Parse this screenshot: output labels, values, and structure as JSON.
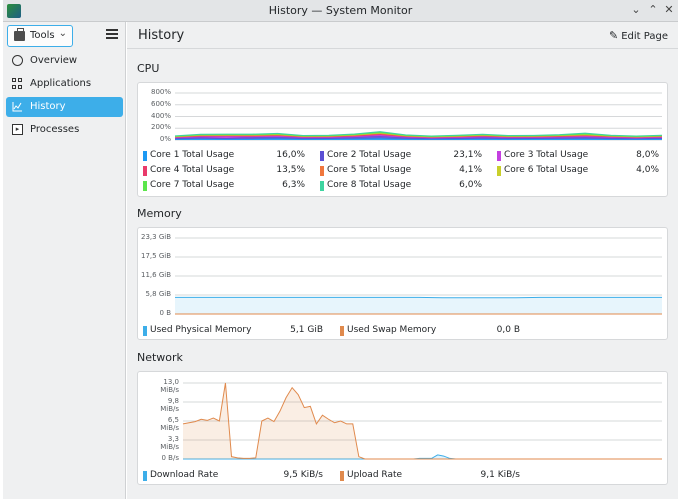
{
  "window": {
    "title": "History — System Monitor"
  },
  "toolbar": {
    "tools_label": "Tools"
  },
  "sidebar": {
    "items": [
      {
        "label": "Overview",
        "icon": "gauge-icon"
      },
      {
        "label": "Applications",
        "icon": "applications-grid-icon"
      },
      {
        "label": "History",
        "icon": "history-chart-icon",
        "active": true
      },
      {
        "label": "Processes",
        "icon": "terminal-icon"
      }
    ]
  },
  "header": {
    "title": "History",
    "edit_label": "Edit Page"
  },
  "cpu": {
    "title": "CPU",
    "legend": [
      {
        "name": "Core 1 Total Usage",
        "value": "16,0%",
        "color": "#1d99f3"
      },
      {
        "name": "Core 2 Total Usage",
        "value": "23,1%",
        "color": "#5a4fd4"
      },
      {
        "name": "Core 3 Total Usage",
        "value": "8,0%",
        "color": "#c43fe0"
      },
      {
        "name": "Core 4 Total Usage",
        "value": "13,5%",
        "color": "#e93a6b"
      },
      {
        "name": "Core 5 Total Usage",
        "value": "4,1%",
        "color": "#f0773d"
      },
      {
        "name": "Core 6 Total Usage",
        "value": "4,0%",
        "color": "#c9cf2b"
      },
      {
        "name": "Core 7 Total Usage",
        "value": "6,3%",
        "color": "#5ce64c"
      },
      {
        "name": "Core 8 Total Usage",
        "value": "6,0%",
        "color": "#3ed4a0"
      }
    ]
  },
  "memory": {
    "title": "Memory",
    "legend": [
      {
        "name": "Used Physical Memory",
        "value": "5,1 GiB",
        "color": "#3daee9"
      },
      {
        "name": "Used Swap Memory",
        "value": "0,0 B",
        "color": "#e08a4d"
      }
    ]
  },
  "network": {
    "title": "Network",
    "legend": [
      {
        "name": "Download Rate",
        "value": "9,5 KiB/s",
        "color": "#3daee9"
      },
      {
        "name": "Upload Rate",
        "value": "9,1 KiB/s",
        "color": "#e08a4d"
      }
    ]
  },
  "chart_data": [
    {
      "type": "area",
      "title": "CPU",
      "y_ticks": [
        "800%",
        "600%",
        "400%",
        "200%",
        "0%"
      ],
      "ylim": [
        0,
        800
      ],
      "grid": true,
      "legend_placement": "bottom",
      "series": [
        {
          "name": "Core 1 Total Usage",
          "color": "#1d99f3",
          "values": [
            12,
            20,
            15,
            18,
            25,
            14,
            16,
            22,
            30,
            18,
            12,
            15,
            20,
            14,
            16,
            18,
            22,
            15,
            12,
            16
          ]
        },
        {
          "name": "Core 2 Total Usage",
          "color": "#5a4fd4",
          "values": [
            20,
            25,
            18,
            30,
            28,
            22,
            20,
            26,
            35,
            24,
            18,
            20,
            25,
            22,
            20,
            24,
            28,
            22,
            18,
            23
          ]
        },
        {
          "name": "Core 3 Total Usage",
          "color": "#c43fe0",
          "values": [
            8,
            12,
            30,
            10,
            15,
            8,
            10,
            12,
            20,
            10,
            8,
            10,
            12,
            8,
            9,
            10,
            14,
            10,
            8,
            8
          ]
        },
        {
          "name": "Core 4 Total Usage",
          "color": "#e93a6b",
          "values": [
            10,
            14,
            12,
            16,
            14,
            12,
            12,
            15,
            18,
            12,
            10,
            12,
            14,
            12,
            12,
            14,
            16,
            12,
            10,
            13
          ]
        },
        {
          "name": "Core 5 Total Usage",
          "color": "#f0773d",
          "values": [
            4,
            6,
            5,
            5,
            6,
            4,
            5,
            6,
            8,
            5,
            4,
            5,
            6,
            4,
            5,
            5,
            6,
            5,
            4,
            4
          ]
        },
        {
          "name": "Core 6 Total Usage",
          "color": "#c9cf2b",
          "values": [
            4,
            5,
            4,
            6,
            5,
            4,
            4,
            5,
            7,
            4,
            4,
            5,
            5,
            4,
            4,
            5,
            6,
            4,
            4,
            4
          ]
        },
        {
          "name": "Core 7 Total Usage",
          "color": "#5ce64c",
          "values": [
            6,
            8,
            10,
            7,
            12,
            6,
            7,
            9,
            14,
            8,
            6,
            7,
            9,
            6,
            7,
            8,
            16,
            7,
            6,
            6
          ]
        },
        {
          "name": "Core 8 Total Usage",
          "color": "#3ed4a0",
          "values": [
            6,
            7,
            6,
            8,
            7,
            6,
            6,
            7,
            10,
            6,
            6,
            7,
            7,
            6,
            6,
            7,
            8,
            6,
            6,
            6
          ]
        }
      ]
    },
    {
      "type": "area",
      "title": "Memory",
      "y_ticks": [
        "23,3 GiB",
        "17,5 GiB",
        "11,6 GiB",
        "5,8 GiB",
        "0 B"
      ],
      "ylim": [
        0,
        23.3
      ],
      "grid": true,
      "legend_placement": "bottom",
      "series": [
        {
          "name": "Used Physical Memory",
          "color": "#3daee9",
          "values": [
            5.1,
            5.1,
            5.1,
            5.1,
            5.1,
            5.1,
            5.1,
            5.1,
            5.1,
            5.1,
            5.1,
            5.0,
            5.0,
            5.0,
            5.0,
            5.1,
            5.1,
            5.1,
            5.1,
            5.1,
            5.1
          ]
        },
        {
          "name": "Used Swap Memory",
          "color": "#e08a4d",
          "values": [
            0,
            0,
            0,
            0,
            0,
            0,
            0,
            0,
            0,
            0,
            0,
            0,
            0,
            0,
            0,
            0,
            0,
            0,
            0,
            0,
            0
          ]
        }
      ]
    },
    {
      "type": "area",
      "title": "Network",
      "y_ticks": [
        "13,0 MiB/s",
        "9,8 MiB/s",
        "6,5 MiB/s",
        "3,3 MiB/s",
        "0 B/s"
      ],
      "ylim": [
        0,
        13.0
      ],
      "grid": true,
      "legend_placement": "bottom",
      "series": [
        {
          "name": "Download Rate",
          "color": "#3daee9",
          "values": [
            0,
            0,
            0,
            0,
            0,
            0,
            0,
            0,
            0,
            0,
            0,
            0,
            0,
            0,
            0,
            0,
            0,
            0,
            0,
            0,
            0,
            0,
            0,
            0,
            0,
            0,
            0,
            0,
            0,
            0,
            0,
            0,
            0,
            0,
            0,
            0,
            0,
            0,
            0,
            0.1,
            0.1,
            0.1,
            0.7,
            0.5,
            0.1,
            0,
            0,
            0,
            0,
            0,
            0,
            0,
            0,
            0,
            0,
            0,
            0,
            0,
            0,
            0,
            0,
            0,
            0,
            0,
            0,
            0,
            0,
            0,
            0,
            0,
            0,
            0,
            0,
            0,
            0,
            0,
            0,
            0,
            0,
            0
          ]
        },
        {
          "name": "Upload Rate",
          "color": "#e08a4d",
          "values": [
            6.0,
            6.2,
            6.4,
            6.8,
            6.6,
            7.0,
            6.5,
            13.0,
            0.4,
            0.2,
            0.1,
            0.1,
            0.2,
            6.5,
            7.0,
            6.4,
            8.2,
            10.5,
            12.2,
            11.0,
            8.8,
            9.0,
            6.0,
            7.5,
            6.8,
            6.2,
            6.5,
            6.0,
            6.0,
            0.4,
            0,
            0,
            0,
            0,
            0,
            0,
            0,
            0,
            0,
            0,
            0,
            0,
            0,
            0,
            0,
            0,
            0,
            0,
            0,
            0,
            0,
            0,
            0,
            0,
            0,
            0,
            0,
            0,
            0,
            0,
            0,
            0,
            0,
            0,
            0,
            0,
            0,
            0,
            0,
            0,
            0,
            0,
            0,
            0,
            0,
            0,
            0,
            0,
            0,
            0
          ]
        }
      ]
    }
  ]
}
